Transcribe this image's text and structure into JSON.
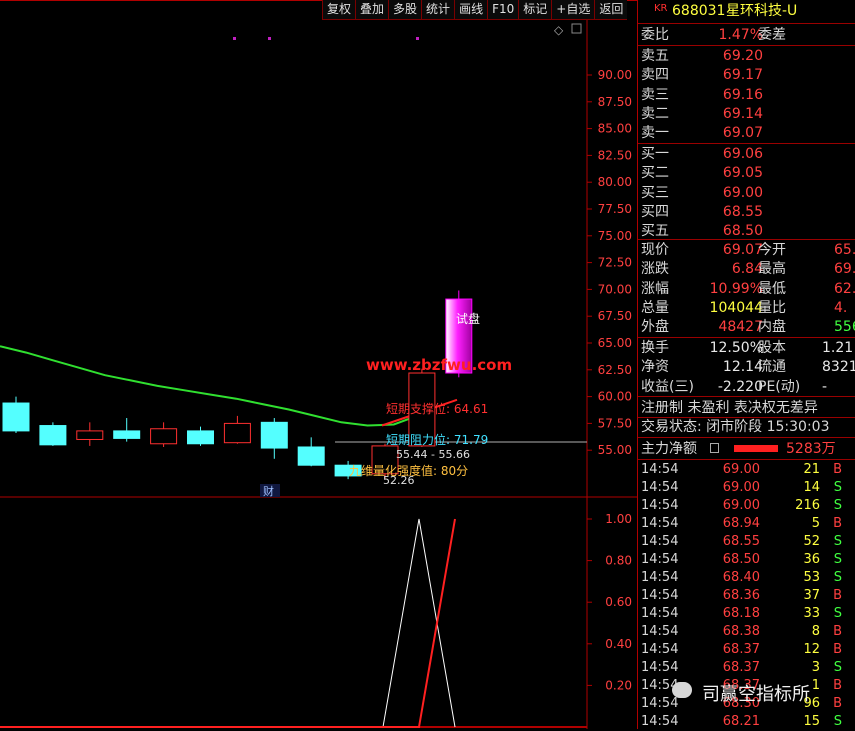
{
  "toolbar": {
    "items": [
      "复权",
      "叠加",
      "多股",
      "统计",
      "画线",
      "F10",
      "标记",
      "+自选",
      "返回"
    ]
  },
  "price_axis": {
    "ticks": [
      "90.00",
      "87.50",
      "85.00",
      "82.50",
      "80.00",
      "77.50",
      "75.00",
      "72.50",
      "70.00",
      "67.50",
      "65.00",
      "62.50",
      "60.00",
      "57.50",
      "55.00"
    ]
  },
  "indicator_axis": {
    "ticks": [
      "1.00",
      "0.80",
      "0.60",
      "0.40",
      "0.20"
    ]
  },
  "chart_annotations": {
    "test_label": "试盘",
    "watermark": "www.zbzfwu.com",
    "support_text": "短期支撑位: 64.61",
    "resistance_text": "短期阻力位: 71.79",
    "range_text": "55.44 - 55.66",
    "strength_text": "九维量化强度值: 80分",
    "low_label": "52.26",
    "finance_badge": "财",
    "diamond": "◇"
  },
  "chart_data": {
    "type": "candlestick",
    "ylim": [
      52,
      92
    ],
    "candles": [
      {
        "open": 56.8,
        "close": 59.4,
        "high": 60.0,
        "low": 56.6,
        "color": "cyan"
      },
      {
        "open": 55.5,
        "close": 57.3,
        "high": 57.6,
        "low": 55.4,
        "color": "cyan"
      },
      {
        "open": 56.0,
        "close": 56.8,
        "high": 57.6,
        "low": 55.4,
        "color": "red"
      },
      {
        "open": 56.1,
        "close": 56.8,
        "high": 58.0,
        "low": 55.8,
        "color": "cyan"
      },
      {
        "open": 55.6,
        "close": 57.0,
        "high": 57.6,
        "low": 55.3,
        "color": "red"
      },
      {
        "open": 55.6,
        "close": 56.8,
        "high": 57.2,
        "low": 55.4,
        "color": "cyan"
      },
      {
        "open": 55.7,
        "close": 57.5,
        "high": 58.2,
        "low": 55.6,
        "color": "red"
      },
      {
        "open": 55.2,
        "close": 57.6,
        "high": 58.0,
        "low": 54.2,
        "color": "cyan"
      },
      {
        "open": 53.6,
        "close": 55.3,
        "high": 56.2,
        "low": 53.5,
        "color": "cyan"
      },
      {
        "open": 52.6,
        "close": 53.6,
        "high": 54.0,
        "low": 52.3,
        "color": "cyan"
      },
      {
        "open": 52.8,
        "close": 55.4,
        "high": 55.6,
        "low": 52.3,
        "color": "red"
      },
      {
        "open": 55.4,
        "close": 62.2,
        "high": 62.6,
        "low": 55.3,
        "color": "red"
      },
      {
        "open": 62.2,
        "close": 69.1,
        "high": 69.9,
        "low": 61.8,
        "color": "magenta"
      }
    ],
    "ma_line": [
      64.7,
      64.1,
      63.4,
      62.7,
      62.0,
      61.5,
      61.0,
      60.6,
      60.2,
      59.8,
      59.3,
      58.8,
      58.2,
      57.6,
      57.3,
      57.4,
      58.3
    ],
    "support_line": [
      57.3,
      58.1,
      58.9,
      59.7
    ],
    "indicator": {
      "white_line": [
        0,
        0,
        1.0,
        0
      ],
      "red_line": [
        0,
        0,
        1.0
      ]
    }
  },
  "quote": {
    "code_prefix": "KR",
    "code": "688031",
    "name": "星环科技-U",
    "weibi_label": "委比",
    "weibi_value": "1.47%",
    "weicha_label": "委差",
    "asks": [
      {
        "label": "卖五",
        "price": "69.20"
      },
      {
        "label": "卖四",
        "price": "69.17"
      },
      {
        "label": "卖三",
        "price": "69.16"
      },
      {
        "label": "卖二",
        "price": "69.14"
      },
      {
        "label": "卖一",
        "price": "69.07"
      }
    ],
    "bids": [
      {
        "label": "买一",
        "price": "69.06"
      },
      {
        "label": "买二",
        "price": "69.05"
      },
      {
        "label": "买三",
        "price": "69.00"
      },
      {
        "label": "买四",
        "price": "68.55"
      },
      {
        "label": "买五",
        "price": "68.50"
      }
    ],
    "stats": [
      {
        "l1": "现价",
        "v1": "69.07",
        "c1": "red",
        "l2": "今开",
        "v2": "65.",
        "c2": "red"
      },
      {
        "l1": "涨跌",
        "v1": "6.84",
        "c1": "red",
        "l2": "最高",
        "v2": "69.",
        "c2": "red"
      },
      {
        "l1": "涨幅",
        "v1": "10.99%",
        "c1": "red",
        "l2": "最低",
        "v2": "62.",
        "c2": "red"
      },
      {
        "l1": "总量",
        "v1": "104044",
        "c1": "yellow",
        "l2": "量比",
        "v2": "4.",
        "c2": "red"
      },
      {
        "l1": "外盘",
        "v1": "48427",
        "c1": "red",
        "l2": "内盘",
        "v2": "556",
        "c2": "green"
      }
    ],
    "stats2": [
      {
        "l1": "换手",
        "v1": "12.50%",
        "l2": "股本",
        "v2": "1.21"
      },
      {
        "l1": "净资",
        "v1": "12.14",
        "l2": "流通",
        "v2": "8321"
      },
      {
        "l1": "收益(三)",
        "v1": "-2.220",
        "l2": "PE(动)",
        "v2": "-"
      }
    ],
    "notice": "注册制 未盈利 表决权无差异",
    "trade_status": "交易状态: 闭市阶段 15:30:03",
    "main_flow_label": "主力净额",
    "main_flow_value": "5283万",
    "flow_bar_color": "#ff2020"
  },
  "ticks": [
    {
      "time": "14:54",
      "price": "69.00",
      "vol": "21",
      "dir": "B"
    },
    {
      "time": "14:54",
      "price": "69.00",
      "vol": "14",
      "dir": "S"
    },
    {
      "time": "14:54",
      "price": "69.00",
      "vol": "216",
      "dir": "S"
    },
    {
      "time": "14:54",
      "price": "68.94",
      "vol": "5",
      "dir": "B"
    },
    {
      "time": "14:54",
      "price": "68.55",
      "vol": "52",
      "dir": "S"
    },
    {
      "time": "14:54",
      "price": "68.50",
      "vol": "36",
      "dir": "S"
    },
    {
      "time": "14:54",
      "price": "68.40",
      "vol": "53",
      "dir": "S"
    },
    {
      "time": "14:54",
      "price": "68.36",
      "vol": "37",
      "dir": "B"
    },
    {
      "time": "14:54",
      "price": "68.18",
      "vol": "33",
      "dir": "S"
    },
    {
      "time": "14:54",
      "price": "68.38",
      "vol": "8",
      "dir": "B"
    },
    {
      "time": "14:54",
      "price": "68.37",
      "vol": "12",
      "dir": "B"
    },
    {
      "time": "14:54",
      "price": "68.37",
      "vol": "3",
      "dir": "S"
    },
    {
      "time": "14:54",
      "price": "68.37",
      "vol": "1",
      "dir": "B"
    },
    {
      "time": "14:54",
      "price": "68.30",
      "vol": "96",
      "dir": "B"
    },
    {
      "time": "14:54",
      "price": "68.21",
      "vol": "15",
      "dir": "S"
    }
  ],
  "footer": {
    "wechat_label": "司赢空指标所"
  }
}
